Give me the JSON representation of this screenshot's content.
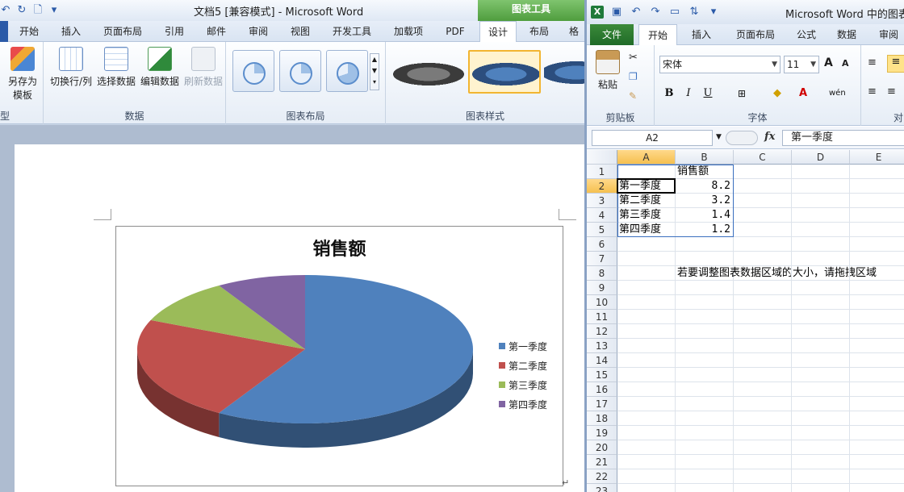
{
  "word": {
    "qat": [
      "↶",
      "↻",
      "🗋",
      "▾"
    ],
    "title": "文档5 [兼容模式] - Microsoft Word",
    "chart_tools": "图表工具",
    "tabs": [
      "开始",
      "插入",
      "页面布局",
      "引用",
      "邮件",
      "审阅",
      "视图",
      "开发工具",
      "加载项",
      "PDF",
      "设计",
      "布局",
      "格"
    ],
    "active_tab": "设计",
    "ribbon": {
      "type_group_tail": "型",
      "save_as_template": [
        "另存为",
        "模板"
      ],
      "switch_row_col": "切换行/列",
      "select_data": "选择数据",
      "edit_data": "编辑数据",
      "refresh_data": "刷新数据",
      "data_group": "数据",
      "layout_group": "图表布局",
      "styles_group": "图表样式"
    },
    "return_mark": "↵"
  },
  "chart_data": {
    "type": "pie",
    "title": "销售额",
    "categories": [
      "第一季度",
      "第二季度",
      "第三季度",
      "第四季度"
    ],
    "values": [
      8.2,
      3.2,
      1.4,
      1.2
    ],
    "colors": [
      "#4f81bd",
      "#c0504d",
      "#9bbb59",
      "#8064a2"
    ],
    "legend_position": "right",
    "style": "3d"
  },
  "excel": {
    "title": "Microsoft Word 中的图表",
    "file_tab": "文件",
    "tabs": [
      "开始",
      "插入",
      "页面布局",
      "公式",
      "数据",
      "审阅"
    ],
    "active_tab": "开始",
    "ribbon": {
      "paste": "粘贴",
      "clipboard_group": "剪贴板",
      "font_group": "字体",
      "font_name": "宋体",
      "font_size": "11",
      "bold": "B",
      "italic": "I",
      "underline": "U",
      "align_group_tail": "对"
    },
    "name_box": "A2",
    "fx": "fx",
    "formula": "第一季度",
    "columns": [
      "A",
      "B",
      "C",
      "D",
      "E"
    ],
    "rows": [
      "1",
      "2",
      "3",
      "4",
      "5",
      "6",
      "7",
      "8",
      "9",
      "10",
      "11",
      "12",
      "13",
      "14",
      "15",
      "16",
      "17",
      "18",
      "19",
      "20",
      "21",
      "22",
      "23"
    ],
    "cells": {
      "B1": "销售额",
      "A2": "第一季度",
      "B2": "8.2",
      "A3": "第二季度",
      "B3": "3.2",
      "A4": "第三季度",
      "B4": "1.4",
      "A5": "第四季度",
      "B5": "1.2",
      "B8": "若要调整图表数据区域的大小，请拖拽区域"
    }
  }
}
